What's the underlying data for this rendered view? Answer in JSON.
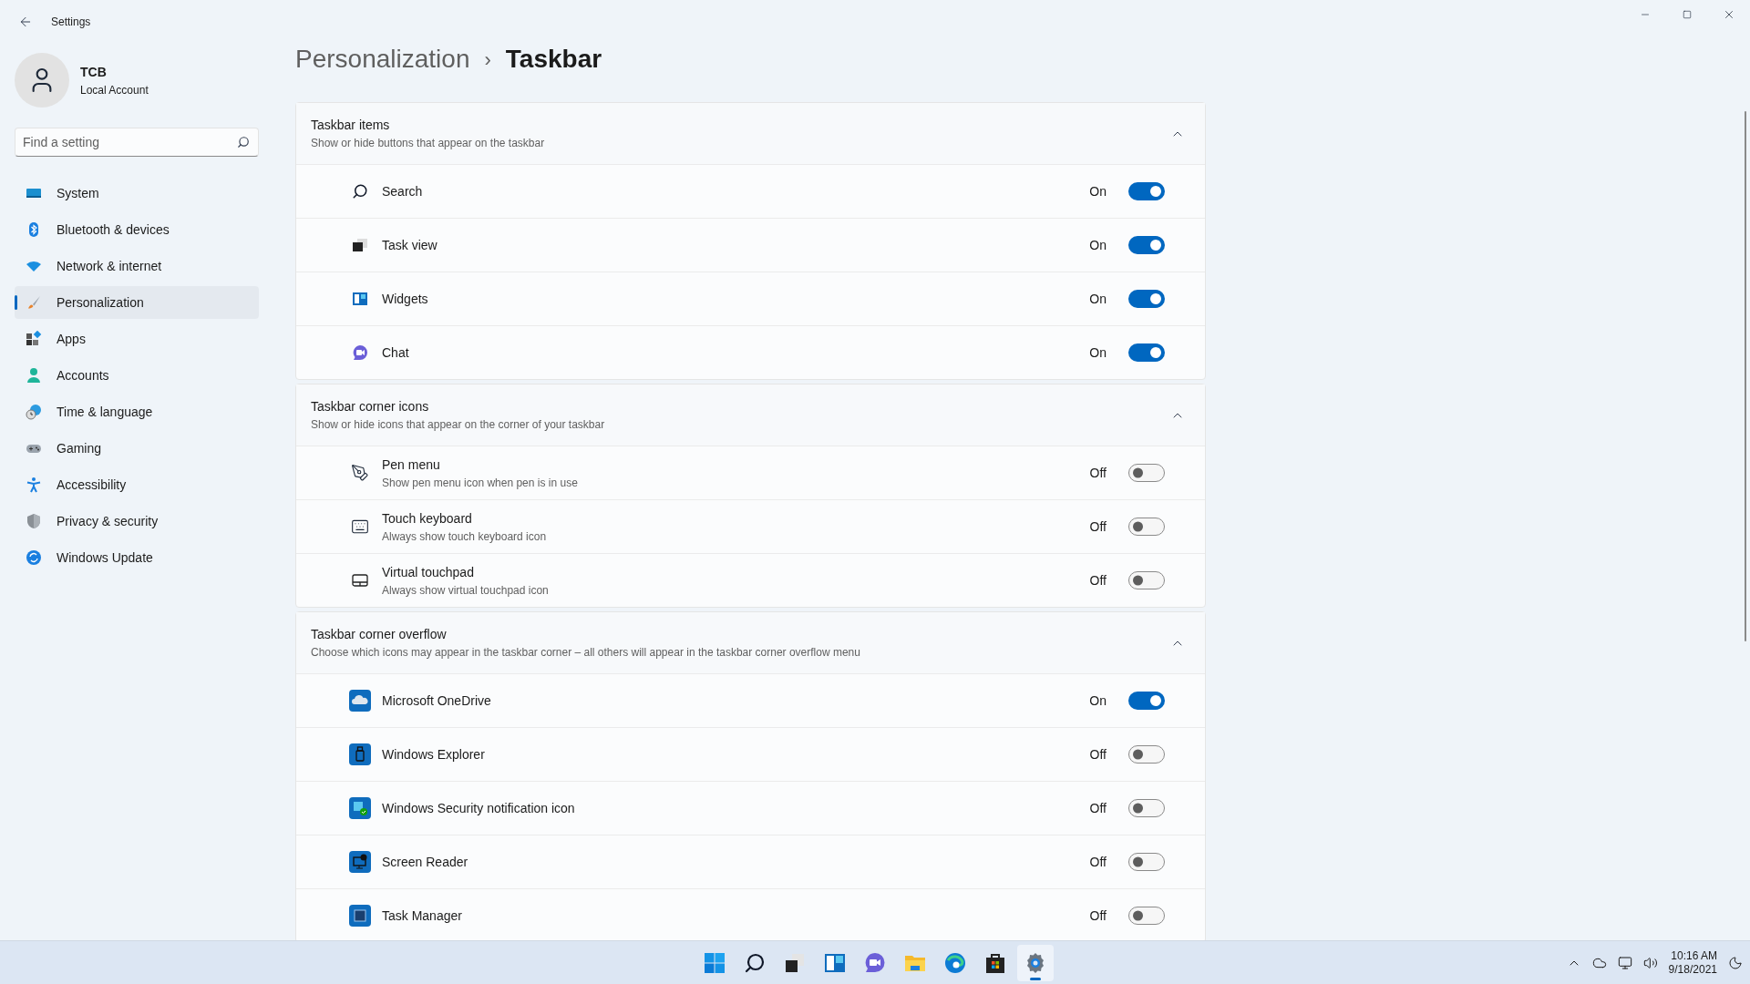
{
  "window": {
    "title": "Settings"
  },
  "account": {
    "name": "TCB",
    "type": "Local Account"
  },
  "search": {
    "placeholder": "Find a setting"
  },
  "sidebar": {
    "items": [
      {
        "label": "System",
        "selected": false
      },
      {
        "label": "Bluetooth & devices",
        "selected": false
      },
      {
        "label": "Network & internet",
        "selected": false
      },
      {
        "label": "Personalization",
        "selected": true
      },
      {
        "label": "Apps",
        "selected": false
      },
      {
        "label": "Accounts",
        "selected": false
      },
      {
        "label": "Time & language",
        "selected": false
      },
      {
        "label": "Gaming",
        "selected": false
      },
      {
        "label": "Accessibility",
        "selected": false
      },
      {
        "label": "Privacy & security",
        "selected": false
      },
      {
        "label": "Windows Update",
        "selected": false
      }
    ]
  },
  "breadcrumb": {
    "parent": "Personalization",
    "separator": "›",
    "current": "Taskbar"
  },
  "sections": [
    {
      "title": "Taskbar items",
      "description": "Show or hide buttons that appear on the taskbar",
      "expanded": true,
      "rows": [
        {
          "label": "Search",
          "on": true,
          "state_label": "On"
        },
        {
          "label": "Task view",
          "on": true,
          "state_label": "On"
        },
        {
          "label": "Widgets",
          "on": true,
          "state_label": "On"
        },
        {
          "label": "Chat",
          "on": true,
          "state_label": "On"
        }
      ]
    },
    {
      "title": "Taskbar corner icons",
      "description": "Show or hide icons that appear on the corner of your taskbar",
      "expanded": true,
      "rows": [
        {
          "label": "Pen menu",
          "description": "Show pen menu icon when pen is in use",
          "on": false,
          "state_label": "Off"
        },
        {
          "label": "Touch keyboard",
          "description": "Always show touch keyboard icon",
          "on": false,
          "state_label": "Off"
        },
        {
          "label": "Virtual touchpad",
          "description": "Always show virtual touchpad icon",
          "on": false,
          "state_label": "Off"
        }
      ]
    },
    {
      "title": "Taskbar corner overflow",
      "description": "Choose which icons may appear in the taskbar corner – all others will appear in the taskbar corner overflow menu",
      "expanded": true,
      "rows": [
        {
          "label": "Microsoft OneDrive",
          "on": true,
          "state_label": "On"
        },
        {
          "label": "Windows Explorer",
          "on": false,
          "state_label": "Off"
        },
        {
          "label": "Windows Security notification icon",
          "on": false,
          "state_label": "Off"
        },
        {
          "label": "Screen Reader",
          "on": false,
          "state_label": "Off"
        },
        {
          "label": "Task Manager",
          "on": false,
          "state_label": "Off"
        }
      ]
    }
  ],
  "taskbar": {
    "apps": [
      {
        "selected": false
      },
      {
        "selected": false
      },
      {
        "selected": false
      },
      {
        "selected": false
      },
      {
        "selected": false
      },
      {
        "selected": false
      },
      {
        "selected": false
      },
      {
        "selected": false
      },
      {
        "selected": true
      }
    ],
    "clock": {
      "time": "10:16 AM",
      "date": "9/18/2021"
    }
  }
}
